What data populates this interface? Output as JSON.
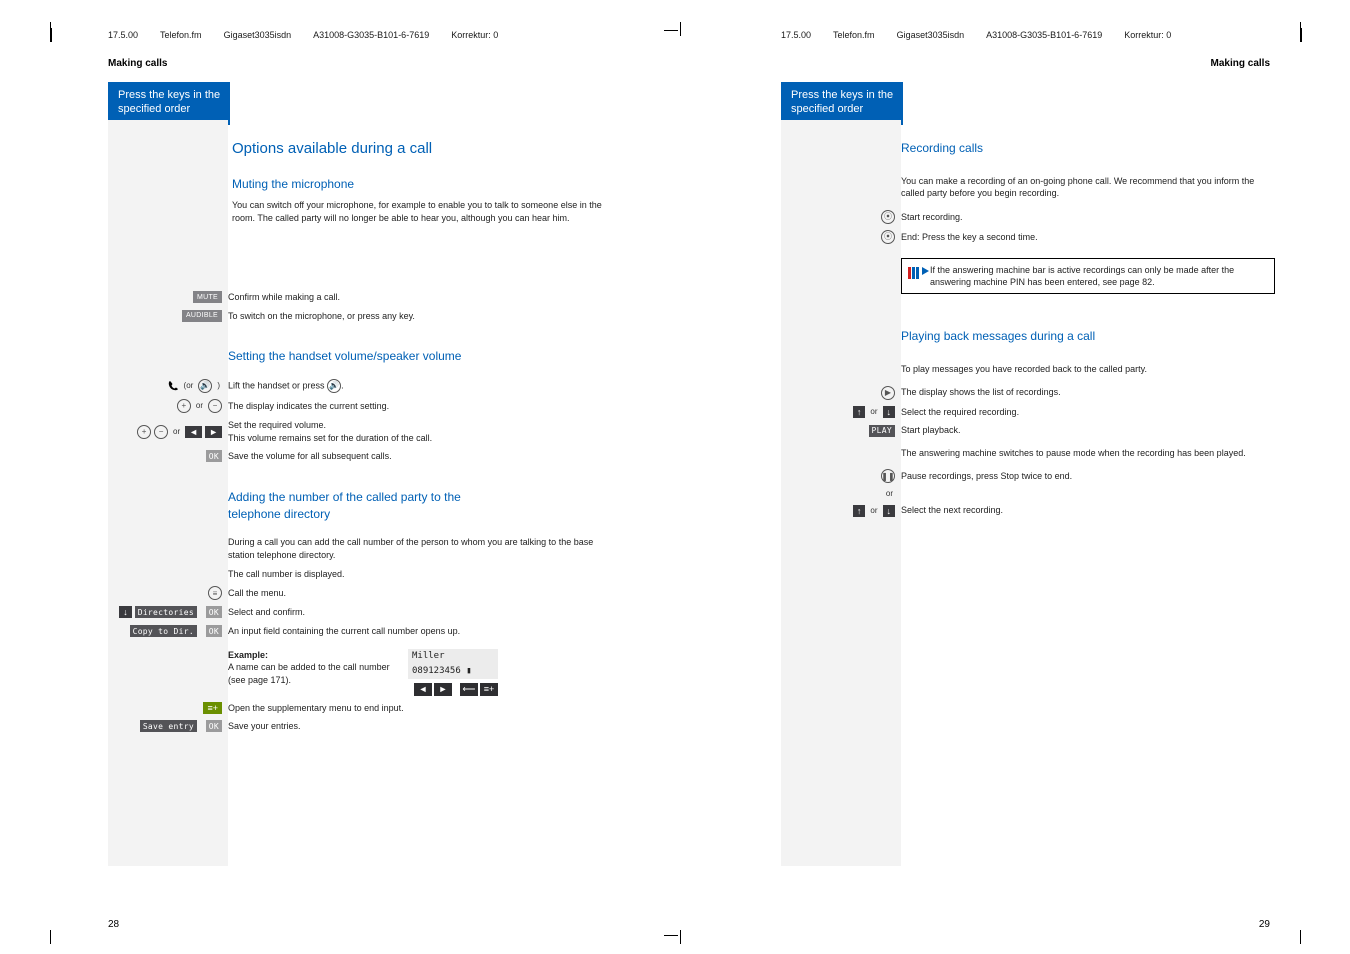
{
  "header": {
    "date": "17.5.00",
    "file": "Telefon.fm",
    "model": "Gigaset3035isdn",
    "doc_id": "A31008-G3035-B101-6-7619",
    "corr": "Korrektur: 0"
  },
  "section_title": "Making calls",
  "blue_box": {
    "line1": "Press the keys in the",
    "line2": "specified order"
  },
  "left": {
    "h1": "Options available during a call",
    "muting": {
      "title": "Muting the microphone",
      "p1": "You can switch off your microphone, for example to enable you to talk to someone else in the room. The called party will no longer be able to hear you, although you can hear him.",
      "mute_label": "MUTE",
      "mute_text": "Confirm while making a call.",
      "audible_label": "AUDIBLE",
      "audible_text": "To switch on the microphone, or press any key."
    },
    "volume": {
      "title": "Setting the handset volume/speaker volume",
      "or_label": "(or",
      "lift_text": "Lift the handset or press",
      "display_text": "The display indicates the current setting.",
      "set_text": "Set the required volume.",
      "set_sub": "This volume remains set for the duration of the call.",
      "ok_label": "OK",
      "save_text": "Save the volume for all subsequent calls."
    },
    "adding": {
      "title_l1": "Adding the number of the called party to the",
      "title_l2": "telephone directory",
      "p1": "During a call you can add the call number of the person to whom you are talking to the base station telephone directory.",
      "p2": "The call number is displayed.",
      "menu_text": "Call the menu.",
      "dirs_label": "Directories",
      "ok_label": "OK",
      "select_text": "Select and confirm.",
      "copy_label": "Copy to Dir.",
      "copy_text": "An input field containing the current call number opens up.",
      "example_bold": "Example:",
      "example_text": "A name can be added to the call number (see page 171).",
      "example_name": "Miller",
      "example_num": "089123456",
      "menu_plus_label": "≡+",
      "open_menu_text": "Open the supplementary menu to end input.",
      "save_entry_label": "Save entry",
      "save_entry_text": "Save your entries."
    },
    "page_num": "28"
  },
  "right": {
    "recording": {
      "title": "Recording calls",
      "p1": "You can make a recording of an on-going phone call. We recommend that you inform the called party before you begin recording.",
      "start_text": "Start recording.",
      "end_text": "End: Press the key a second time.",
      "note": "If the answering machine bar is active recordings can only be made after the answering machine PIN has been entered, see page 82."
    },
    "playback": {
      "title": "Playing back messages during a call",
      "p1": "To play messages you have recorded back to the called party.",
      "list_text": "The display shows the list of recordings.",
      "or": "or",
      "select_text": "Select the required recording.",
      "play_label": "PLAY",
      "start_text": "Start playback.",
      "switch_text": "The answering machine switches to pause mode when the recording has been played.",
      "pause_text": "Pause recordings, press Stop twice to end.",
      "or2": "or",
      "next_text": "Select the next recording."
    },
    "page_num": "29"
  }
}
